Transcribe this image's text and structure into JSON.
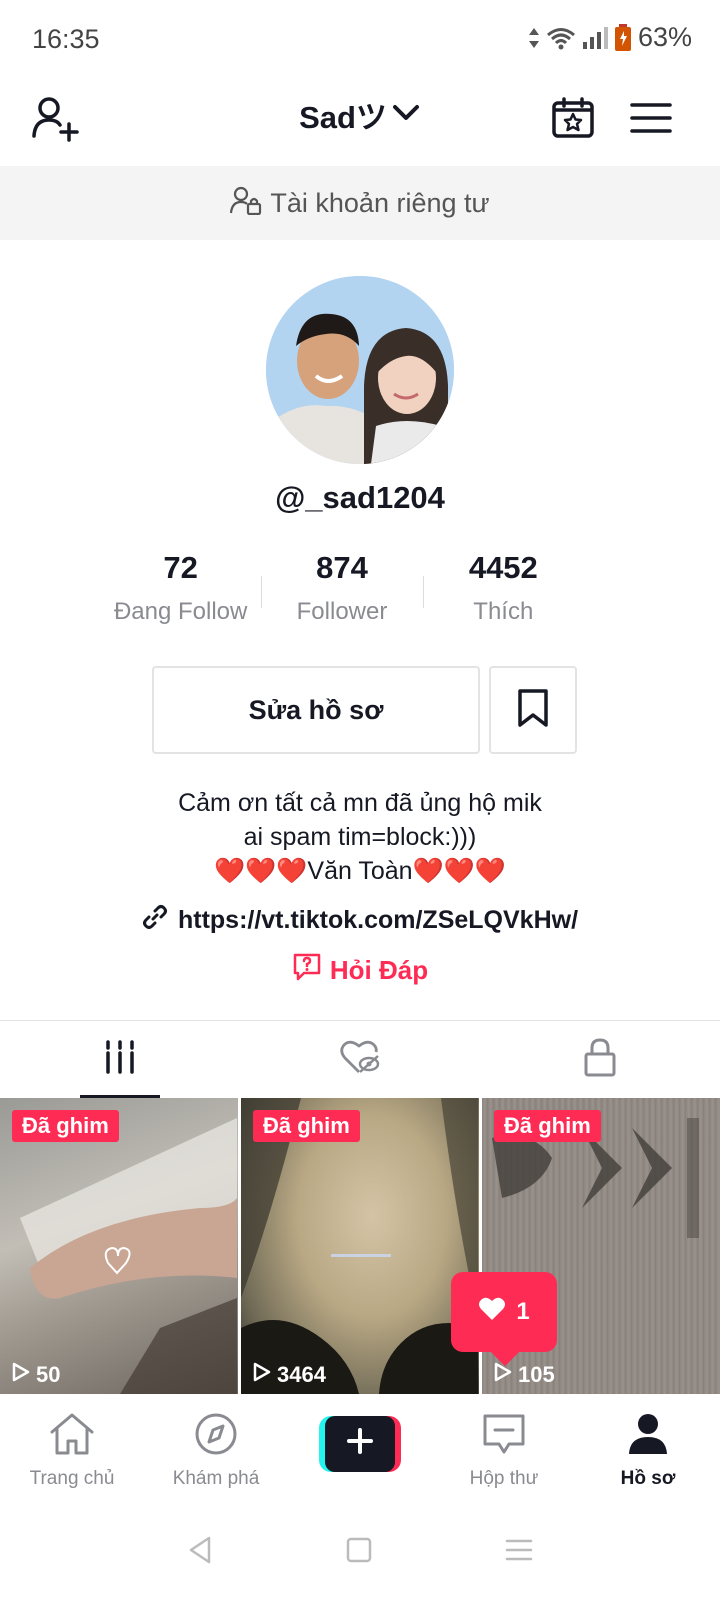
{
  "status_bar": {
    "time": "16:35",
    "battery": "63%"
  },
  "header": {
    "username": "Sadツ"
  },
  "private_banner": {
    "text": "Tài khoản riêng tư"
  },
  "profile": {
    "handle": "@_sad1204",
    "stats": [
      {
        "value": "72",
        "label": "Đang Follow"
      },
      {
        "value": "874",
        "label": "Follower"
      },
      {
        "value": "4452",
        "label": "Thích"
      }
    ],
    "edit_label": "Sửa hồ sơ",
    "bio_lines": [
      "Cảm ơn tất cả mn đã ủng hộ mik",
      "ai spam tim=block:)))",
      "❤️❤️❤️Văn Toàn❤️❤️❤️"
    ],
    "link": "https://vt.tiktok.com/ZSeLQVkHw/",
    "qa_label": "Hỏi Đáp"
  },
  "videos": [
    {
      "badge": "Đã ghim",
      "views": "50"
    },
    {
      "badge": "Đã ghim",
      "views": "3464"
    },
    {
      "badge": "Đã ghim",
      "views": "105"
    }
  ],
  "like_bubble": {
    "count": "1"
  },
  "bottom_nav": {
    "home": "Trang chủ",
    "discover": "Khám phá",
    "inbox": "Hộp thư",
    "profile": "Hồ sơ"
  },
  "colors": {
    "accent": "#fe2c55",
    "cyan": "#25f4ee",
    "text": "#161823",
    "muted": "#8a8b91"
  }
}
